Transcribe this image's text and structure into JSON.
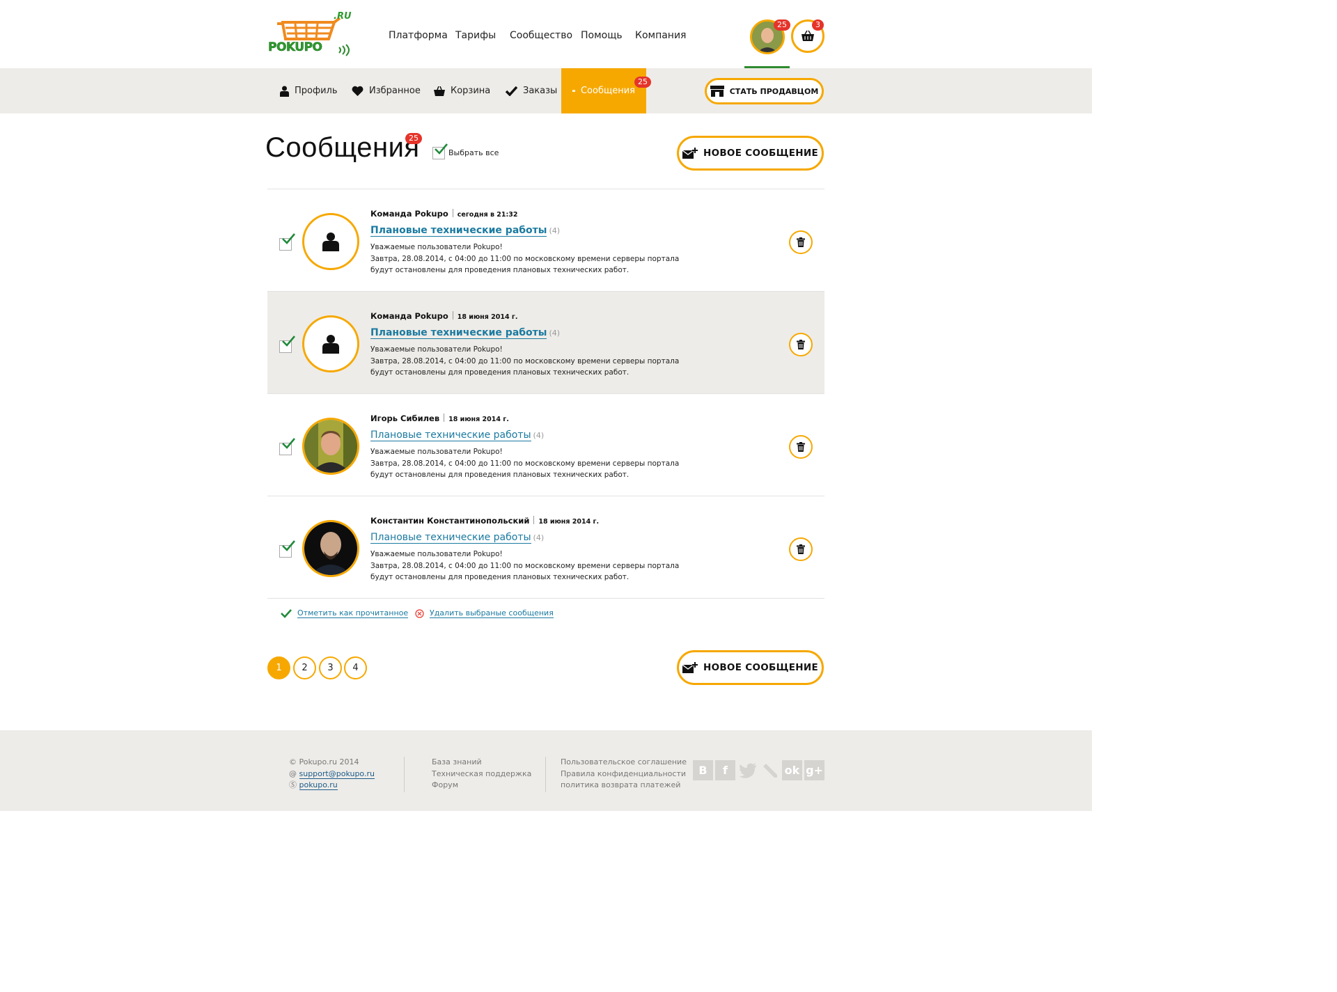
{
  "brand": {
    "logo_text": "POKUPO",
    "logo_suffix": ".RU",
    "accent": "#f6a800",
    "badge": "#e5342a",
    "link": "#1a7aa0"
  },
  "topnav": [
    "Платформа",
    "Тарифы",
    "Сообщество",
    "Помощь",
    "Компания"
  ],
  "user": {
    "avatar_badge": "25",
    "cart_badge": "3"
  },
  "subnav": {
    "profile": "Профиль",
    "favorites": "Избранное",
    "cart": "Корзина",
    "orders": "Заказы",
    "messages": "Сообщения",
    "messages_badge": "25",
    "seller_button": "СТАТЬ ПРОДАВЦОМ"
  },
  "page": {
    "title": "Сообщения",
    "title_badge": "25",
    "select_all": "Выбрать все",
    "new_message": "НОВОЕ СООБЩЕНИЕ"
  },
  "messages": [
    {
      "sender": "Команда Pokupo",
      "date": "сегодня в 21:32",
      "subject": "Плановые технические работы",
      "count": "(4)",
      "line1": "Уважаемые пользователи Pokupo!",
      "line2": "Завтра, 28.08.2014, с 04:00 до 11:00 по московскому времени серверы портала будут остановлены для проведения плановых технических работ.",
      "avatar": "user-silhouette",
      "unread": true
    },
    {
      "sender": "Команда Pokupo",
      "date": "18 июня 2014 г.",
      "subject": "Плановые технические работы",
      "count": "(4)",
      "line1": "Уважаемые пользователи Pokupo!",
      "line2": "Завтра, 28.08.2014, с 04:00 до 11:00 по московскому времени серверы портала будут остановлены для проведения плановых технических работ.",
      "avatar": "user-silhouette",
      "unread": true
    },
    {
      "sender": "Игорь Сибилев",
      "date": "18 июня 2014 г.",
      "subject": "Плановые технические работы",
      "count": "(4)",
      "line1": "Уважаемые пользователи Pokupo!",
      "line2": "Завтра, 28.08.2014, с 04:00 до 11:00 по московскому времени серверы портала будут остановлены для проведения плановых технических работ.",
      "avatar": "photo",
      "unread": false
    },
    {
      "sender": "Константин Константинопольский",
      "date": "18 июня 2014 г.",
      "subject": "Плановые технические работы",
      "count": "(4)",
      "line1": "Уважаемые пользователи Pokupo!",
      "line2": "Завтра, 28.08.2014, с 04:00 до 11:00 по московскому времени серверы портала будут остановлены для проведения плановых технических работ.",
      "avatar": "photo",
      "unread": false
    }
  ],
  "actions": {
    "mark_read": "Отметить как прочитанное",
    "delete_selected": "Удалить выбраные сообщения"
  },
  "pagination": {
    "pages": [
      "1",
      "2",
      "3",
      "4"
    ],
    "current": "1"
  },
  "footer": {
    "copyright": "Pokupo.ru 2014",
    "email": "support@pokupo.ru",
    "skype": "pokupo.ru",
    "col2": [
      "База знаний",
      "Техническая поддержка",
      "Форум"
    ],
    "col3": [
      "Пользовательское соглашение",
      "Правила конфиденциальности",
      "политика возврата платежей"
    ],
    "social": [
      "vk",
      "facebook",
      "twitter",
      "livejournal",
      "odnoklassniki",
      "google-plus"
    ]
  }
}
